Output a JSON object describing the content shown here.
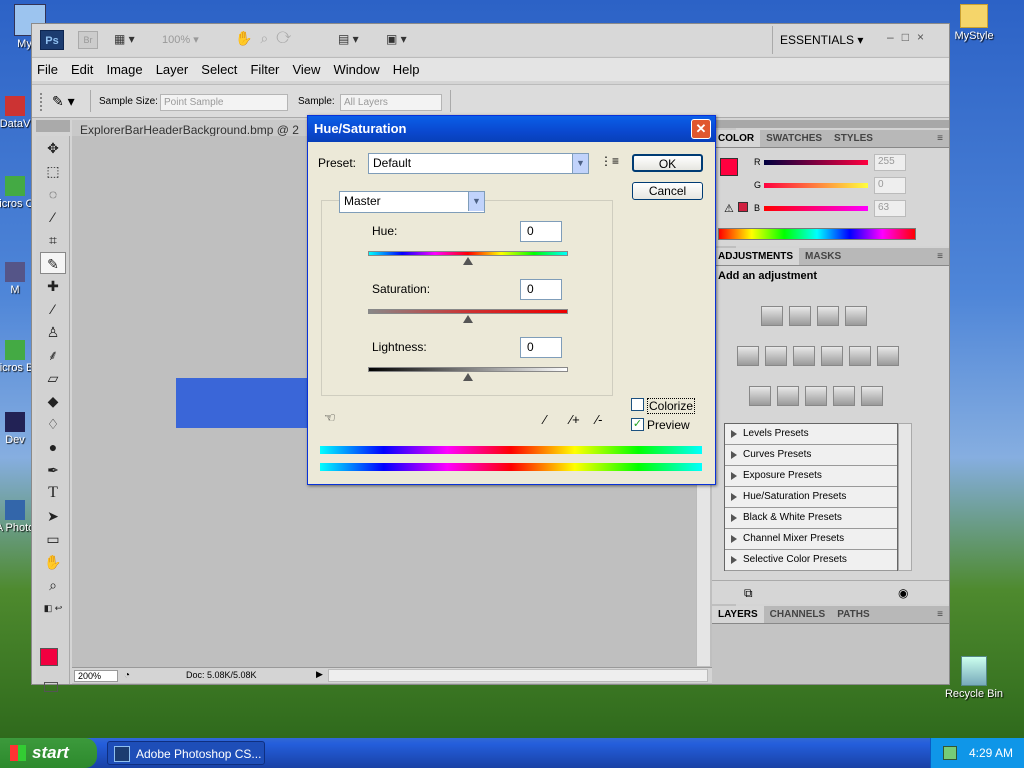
{
  "desktop": {
    "icons_left": [
      "My C",
      "DataV",
      "Micros C+",
      "M",
      "Micros Ba",
      "Dev",
      "A Photo"
    ],
    "icons_right": [
      {
        "label": "MyStyle"
      },
      {
        "label": "Recycle Bin"
      }
    ]
  },
  "app": {
    "zoom_field": "100%",
    "workspace": "ESSENTIALS",
    "menu": [
      "File",
      "Edit",
      "Image",
      "Layer",
      "Select",
      "Filter",
      "View",
      "Window",
      "Help"
    ],
    "options": {
      "sample_size_label": "Sample Size:",
      "sample_size_value": "Point Sample",
      "sample_label": "Sample:",
      "sample_value": "All Layers"
    },
    "doc_tab": "ExplorerBarHeaderBackground.bmp @ 2",
    "status": {
      "zoom": "200%",
      "doc": "Doc: 5.08K/5.08K"
    }
  },
  "color_panel": {
    "tabs": [
      "COLOR",
      "SWATCHES",
      "STYLES"
    ],
    "channels": [
      {
        "label": "R",
        "value": "255"
      },
      {
        "label": "G",
        "value": "0"
      },
      {
        "label": "B",
        "value": "63"
      }
    ],
    "fg_color": "#ff003f"
  },
  "adjustments_panel": {
    "tabs": [
      "ADJUSTMENTS",
      "MASKS"
    ],
    "heading": "Add an adjustment",
    "presets": [
      "Levels Presets",
      "Curves Presets",
      "Exposure Presets",
      "Hue/Saturation Presets",
      "Black & White Presets",
      "Channel Mixer Presets",
      "Selective Color Presets"
    ]
  },
  "layers_panel": {
    "tabs": [
      "LAYERS",
      "CHANNELS",
      "PATHS"
    ]
  },
  "dialog": {
    "title": "Hue/Saturation",
    "preset_label": "Preset:",
    "preset_value": "Default",
    "ok": "OK",
    "cancel": "Cancel",
    "edit_value": "Master",
    "hue": {
      "label": "Hue:",
      "value": "0"
    },
    "saturation": {
      "label": "Saturation:",
      "value": "0"
    },
    "lightness": {
      "label": "Lightness:",
      "value": "0"
    },
    "colorize": "Colorize",
    "preview": "Preview",
    "colorize_checked": false,
    "preview_checked": true
  },
  "taskbar": {
    "start": "start",
    "task": "Adobe Photoshop CS...",
    "clock": "4:29 AM"
  }
}
